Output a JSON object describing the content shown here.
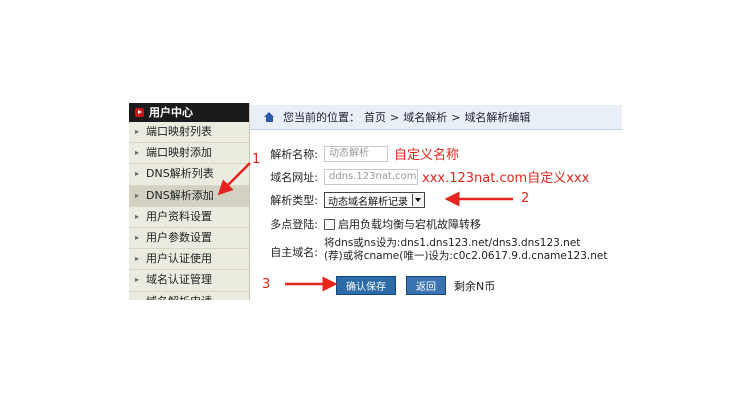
{
  "sidebar": {
    "title": "用户中心",
    "items": [
      {
        "label": "端口映射列表"
      },
      {
        "label": "端口映射添加"
      },
      {
        "label": "DNS解析列表"
      },
      {
        "label": "DNS解析添加",
        "active": true
      },
      {
        "label": "用户资料设置"
      },
      {
        "label": "用户参数设置"
      },
      {
        "label": "用户认证使用"
      },
      {
        "label": "域名认证管理"
      },
      {
        "label": "域名解析申请"
      }
    ]
  },
  "breadcrumb": {
    "prefix": "您当前的位置：",
    "home": "首页",
    "sep": ">",
    "level1": "域名解析",
    "level2": "域名解析编辑"
  },
  "form": {
    "name_label": "解析名称:",
    "name_value": "动态解析",
    "name_note": "自定义名称",
    "domain_label": "域名网址:",
    "domain_value": "ddns.123nat.com",
    "domain_note": "xxx.123nat.com自定义xxx",
    "type_label": "解析类型:",
    "type_value": "动态域名解析记录",
    "multi_label": "多点登陆:",
    "multi_text": "启用负载均衡与宕机故障转移",
    "custom_label": "自主域名:",
    "custom_line1": "将dns或ns设为:dns1.dns123.net/dns3.dns123.net",
    "custom_line2": "(荐)或将cname(唯一)设为:c0c2.0617.9.d.cname123.net",
    "save_label": "确认保存",
    "back_label": "返回",
    "remain_text": "剩余N币"
  },
  "annotations": {
    "n1": "1",
    "n2": "2",
    "n3": "3"
  },
  "colors": {
    "annotation": "#e4251d",
    "button": "#2c6aa8",
    "sidebar_head": "#1b1b1b"
  }
}
